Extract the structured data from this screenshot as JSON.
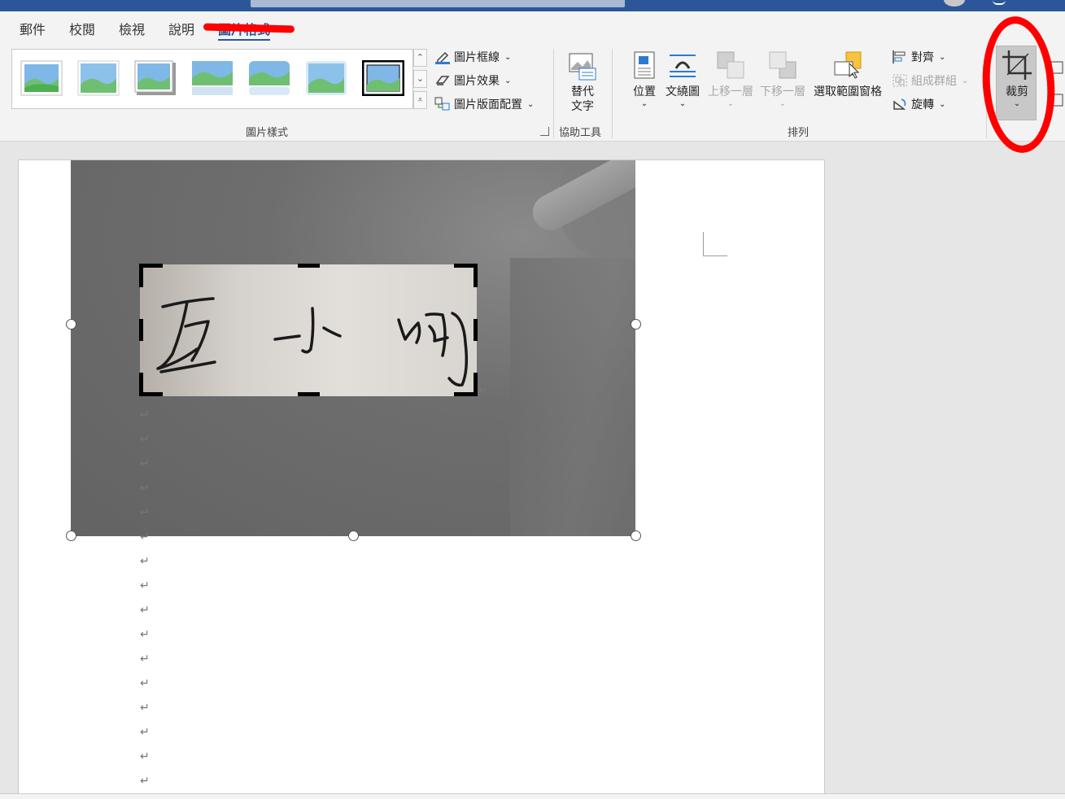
{
  "tabs": [
    {
      "label": "郵件"
    },
    {
      "label": "校閱"
    },
    {
      "label": "檢視"
    },
    {
      "label": "說明"
    },
    {
      "label": "圖片格式",
      "active": true
    }
  ],
  "picture_styles": {
    "group_label": "圖片樣式",
    "thumb_count": 7,
    "commands": {
      "border": "圖片框線",
      "effects": "圖片效果",
      "layout": "圖片版面配置"
    }
  },
  "accessibility": {
    "group_label": "協助工具",
    "alt_text_line1": "替代",
    "alt_text_line2": "文字"
  },
  "arrange": {
    "group_label": "排列",
    "position": "位置",
    "wrap_text": "文繞圖",
    "bring_forward": "上移一層",
    "send_backward": "下移一層",
    "selection_pane": "選取範圍窗格",
    "align": "對齊",
    "group": "組成群組",
    "rotate": "旋轉"
  },
  "size": {
    "crop": "裁剪"
  },
  "document": {
    "paragraph_mark": "↵",
    "paragraph_count": 16
  },
  "colors": {
    "accent": "#2b579a",
    "annotation": "#ff0000"
  }
}
